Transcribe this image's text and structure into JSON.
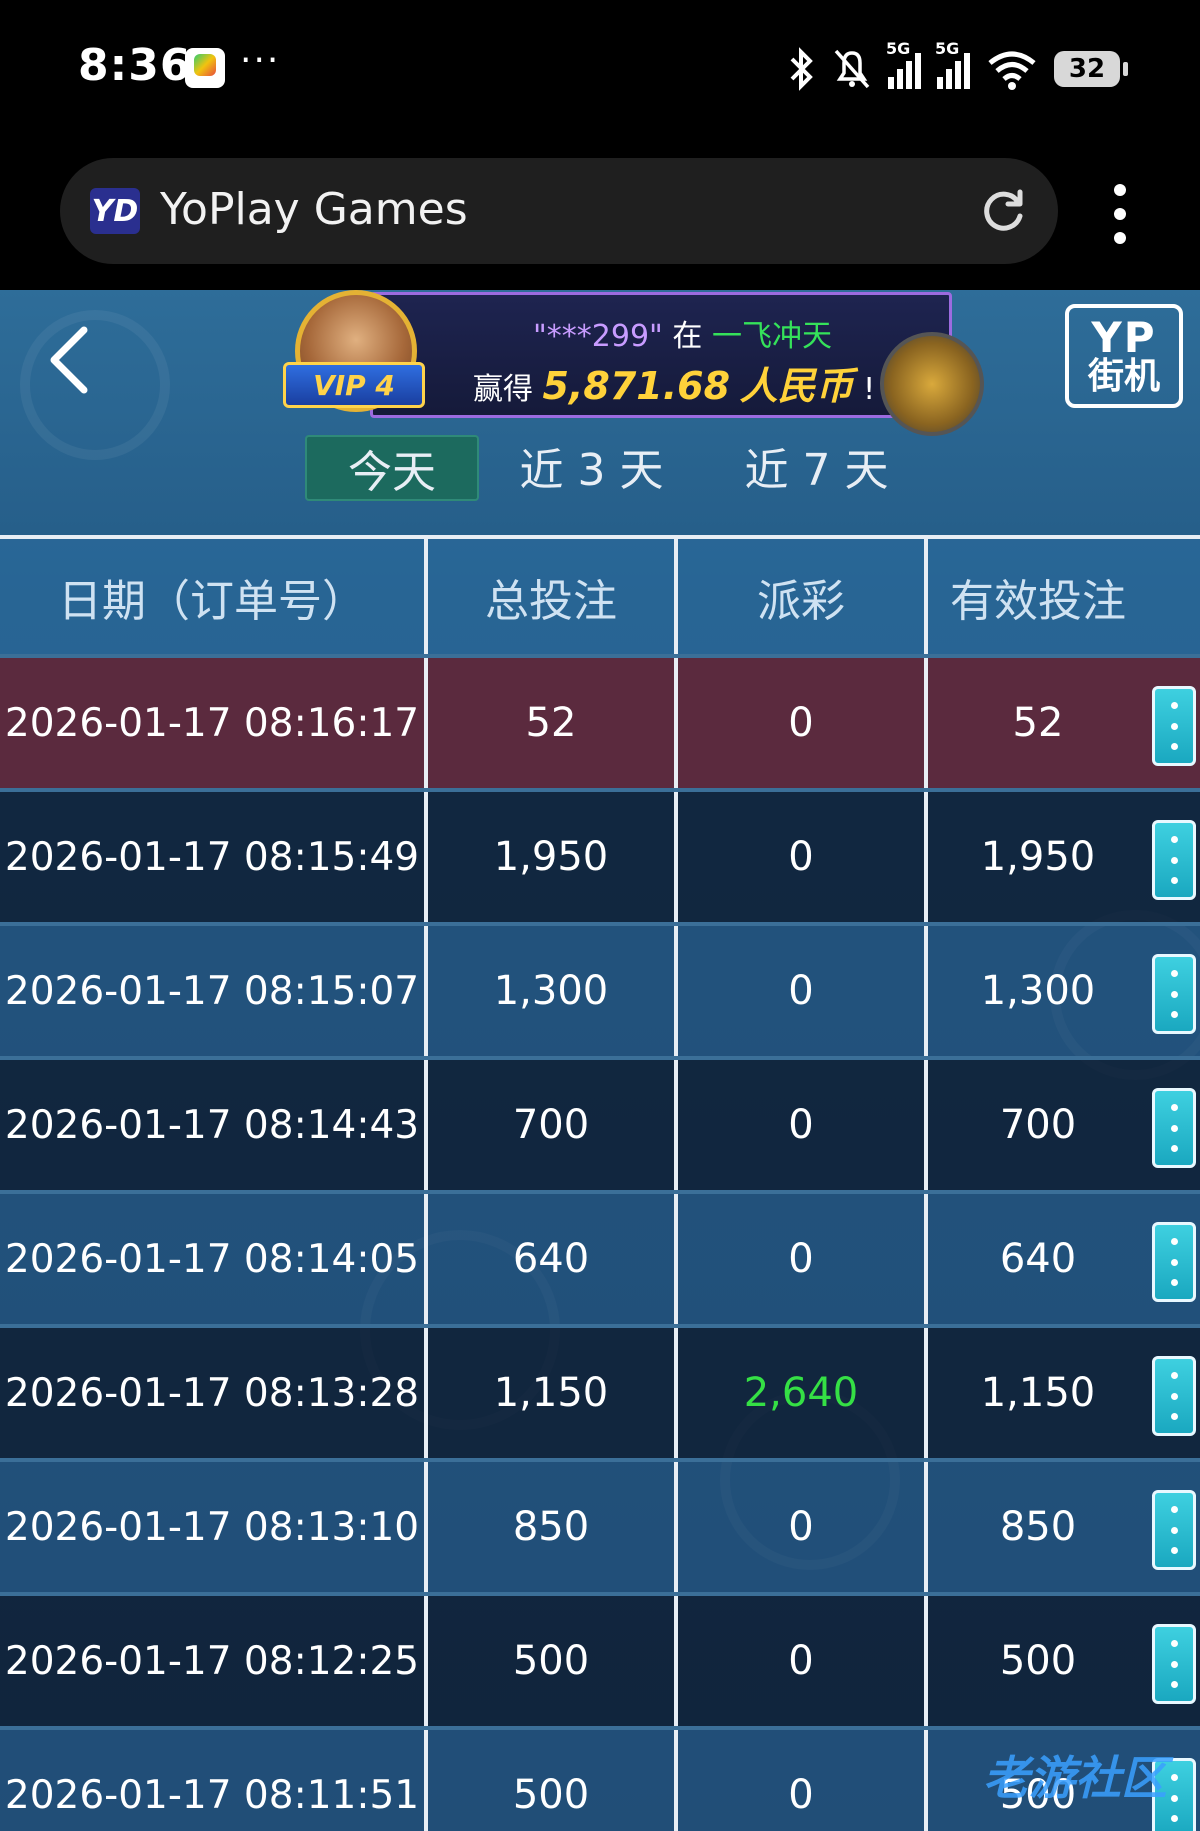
{
  "status": {
    "time": "8:36",
    "dots": "···",
    "battery": "32",
    "signal_label_1": "5G",
    "signal_label_2": "5G"
  },
  "browser": {
    "logo_text": "YD",
    "title": "YoPlay Games"
  },
  "banner": {
    "user": "\"***299\"",
    "in_text": "在",
    "game_name": "一飞冲天",
    "won_text": "赢得",
    "amount": "5,871.68",
    "currency": "人民币",
    "exclaim": "!",
    "vip": "VIP 4"
  },
  "brand": {
    "line1": "YP",
    "line2": "街机"
  },
  "tabs": [
    {
      "label": "今天",
      "active": true
    },
    {
      "label": "近 3 天",
      "active": false
    },
    {
      "label": "近 7 天",
      "active": false
    }
  ],
  "table": {
    "headers": [
      "日期（订单号）",
      "总投注",
      "派彩",
      "有效投注"
    ],
    "rows": [
      {
        "date": "2026-01-17 08:16:17",
        "total": "52",
        "payout": "0",
        "valid": "52"
      },
      {
        "date": "2026-01-17 08:15:49",
        "total": "1,950",
        "payout": "0",
        "valid": "1,950"
      },
      {
        "date": "2026-01-17 08:15:07",
        "total": "1,300",
        "payout": "0",
        "valid": "1,300"
      },
      {
        "date": "2026-01-17 08:14:43",
        "total": "700",
        "payout": "0",
        "valid": "700"
      },
      {
        "date": "2026-01-17 08:14:05",
        "total": "640",
        "payout": "0",
        "valid": "640"
      },
      {
        "date": "2026-01-17 08:13:28",
        "total": "1,150",
        "payout": "2,640",
        "valid": "1,150"
      },
      {
        "date": "2026-01-17 08:13:10",
        "total": "850",
        "payout": "0",
        "valid": "850"
      },
      {
        "date": "2026-01-17 08:12:25",
        "total": "500",
        "payout": "0",
        "valid": "500"
      },
      {
        "date": "2026-01-17 08:11:51",
        "total": "500",
        "payout": "0",
        "valid": "500"
      }
    ]
  },
  "colors": {
    "win_payout": "#35e045",
    "selected_row": "#5b2a3e",
    "active_tab": "#1c6a5e"
  },
  "watermark": "老游社区"
}
